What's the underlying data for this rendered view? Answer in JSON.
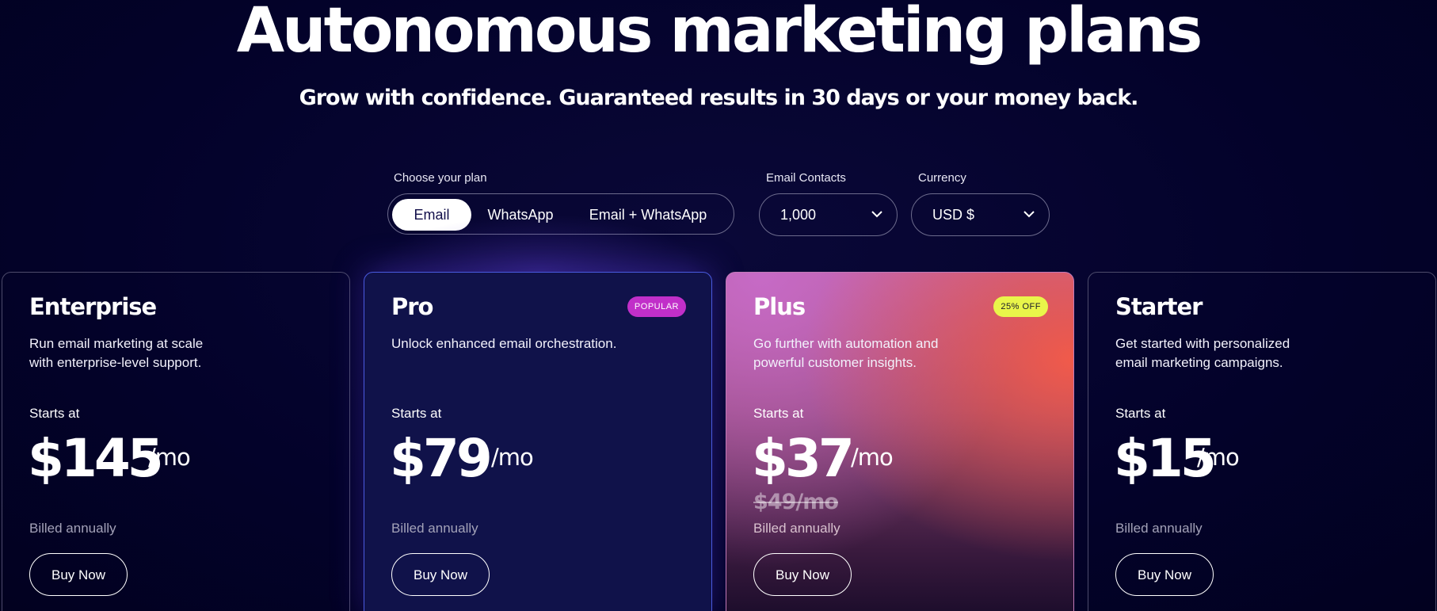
{
  "hero": {
    "title": "Autonomous marketing plans",
    "subtitle": "Grow with confidence. Guaranteed results in 30 days or your money back."
  },
  "controls": {
    "plan_label": "Choose your plan",
    "plan_options": [
      "Email",
      "WhatsApp",
      "Email + WhatsApp"
    ],
    "plan_selected": "Email",
    "contacts_label": "Email Contacts",
    "contacts_value": "1,000",
    "currency_label": "Currency",
    "currency_value": "USD $"
  },
  "plans": [
    {
      "name": "Enterprise",
      "description": "Run email marketing at scale with enterprise-level support.",
      "starts_label": "Starts at",
      "price": "$145",
      "period": "/mo",
      "billing": "Billed annually",
      "cta": "Buy Now"
    },
    {
      "name": "Pro",
      "badge": "POPULAR",
      "description": "Unlock enhanced email orchestration.",
      "starts_label": "Starts at",
      "price": "$79",
      "period": "/mo",
      "billing": "Billed annually",
      "cta": "Buy Now"
    },
    {
      "name": "Plus",
      "badge": "25% OFF",
      "description": "Go further with automation and powerful customer insights.",
      "starts_label": "Starts at",
      "price": "$37",
      "period": "/mo",
      "old_price": "$49/mo",
      "billing": "Billed annually",
      "cta": "Buy Now"
    },
    {
      "name": "Starter",
      "description": "Get started with personalized email marketing campaigns.",
      "starts_label": "Starts at",
      "price": "$15",
      "period": "/mo",
      "billing": "Billed annually",
      "cta": "Buy Now"
    }
  ],
  "colors": {
    "background": "#03022a",
    "pro_card": "#10124a",
    "popular_badge": "#c12fc9",
    "discount_badge": "#e9f54a"
  },
  "icons": {
    "select_chevron": "chevron-down-icon"
  }
}
